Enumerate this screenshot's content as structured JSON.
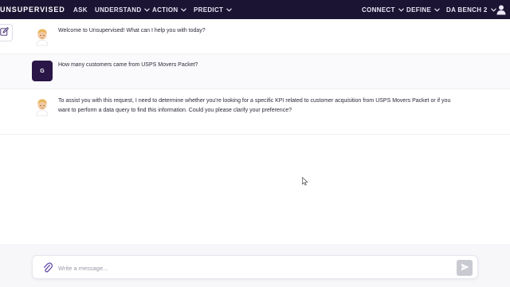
{
  "brand": "UNSUPERVISED",
  "nav": {
    "ask": "ASK",
    "understand": "UNDERSTAND",
    "action": "ACTION",
    "predict": "PREDICT",
    "connect": "CONNECT",
    "define": "DEFINE",
    "workspace": "DA BENCH 2"
  },
  "chat": {
    "messages": [
      {
        "role": "assistant",
        "text": "Welcome to Unsupervised! What can I help you with today?"
      },
      {
        "role": "user",
        "initial": "G",
        "text": "How many customers came from USPS Movers Packet?"
      },
      {
        "role": "assistant",
        "text": "To assist you with this request, I need to determine whether you're looking for a specific KPI related to customer acquisition from USPS Movers Packet or if you want to perform a data query to find this information. Could you please clarify your preference?"
      }
    ]
  },
  "composer": {
    "placeholder": "Write a message..."
  },
  "colors": {
    "topbar": "#1c1433",
    "user_avatar": "#2a1647",
    "send_button": "#c9c9d2"
  }
}
